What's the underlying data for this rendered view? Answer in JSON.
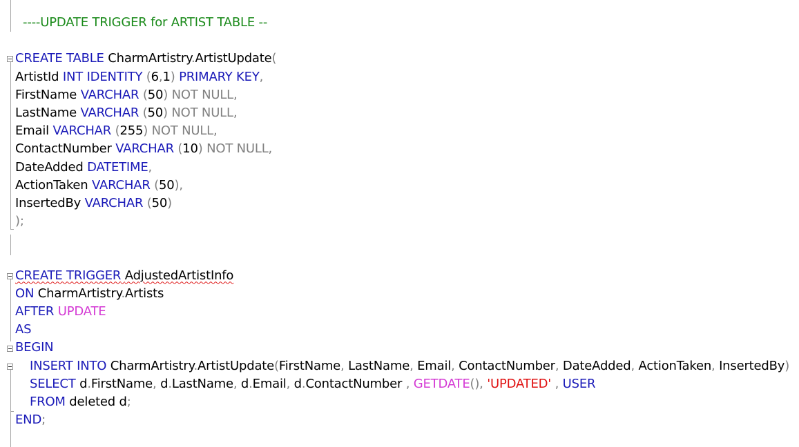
{
  "editor": {
    "colors": {
      "keyword": "#1a1ab8",
      "function": "#d43ad4",
      "operator": "#808080",
      "comment": "#1a8a1a",
      "string": "#e01010",
      "identifier": "#000000"
    },
    "lines": [
      {
        "id": "comment",
        "tokens": [
          {
            "t": "  ----UPDATE TRIGGER for ARTIST TABLE --",
            "c": "cm"
          }
        ]
      },
      {
        "id": "blank-1",
        "tokens": []
      },
      {
        "id": "create-table",
        "tokens": [
          {
            "t": "CREATE TABLE",
            "c": "kw"
          },
          {
            "t": " CharmArtistry",
            "c": ""
          },
          {
            "t": ".",
            "c": "gr"
          },
          {
            "t": "ArtistUpdate",
            "c": ""
          },
          {
            "t": "(",
            "c": "gr"
          }
        ]
      },
      {
        "id": "col-artistid",
        "tokens": [
          {
            "t": "ArtistId ",
            "c": ""
          },
          {
            "t": "INT IDENTITY",
            "c": "kw"
          },
          {
            "t": " (",
            "c": "gr"
          },
          {
            "t": "6",
            "c": ""
          },
          {
            "t": ",",
            "c": "gr"
          },
          {
            "t": "1",
            "c": ""
          },
          {
            "t": ") ",
            "c": "gr"
          },
          {
            "t": "PRIMARY KEY",
            "c": "kw"
          },
          {
            "t": ",",
            "c": "gr"
          }
        ]
      },
      {
        "id": "col-firstname",
        "tokens": [
          {
            "t": "FirstName ",
            "c": ""
          },
          {
            "t": "VARCHAR",
            "c": "kw"
          },
          {
            "t": " (",
            "c": "gr"
          },
          {
            "t": "50",
            "c": ""
          },
          {
            "t": ") NOT NULL,",
            "c": "gr"
          }
        ]
      },
      {
        "id": "col-lastname",
        "tokens": [
          {
            "t": "LastName ",
            "c": ""
          },
          {
            "t": "VARCHAR",
            "c": "kw"
          },
          {
            "t": " (",
            "c": "gr"
          },
          {
            "t": "50",
            "c": ""
          },
          {
            "t": ") NOT NULL,",
            "c": "gr"
          }
        ]
      },
      {
        "id": "col-email",
        "tokens": [
          {
            "t": "Email ",
            "c": ""
          },
          {
            "t": "VARCHAR",
            "c": "kw"
          },
          {
            "t": " (",
            "c": "gr"
          },
          {
            "t": "255",
            "c": ""
          },
          {
            "t": ") NOT NULL,",
            "c": "gr"
          }
        ]
      },
      {
        "id": "col-contactnumber",
        "tokens": [
          {
            "t": "ContactNumber ",
            "c": ""
          },
          {
            "t": "VARCHAR",
            "c": "kw"
          },
          {
            "t": " (",
            "c": "gr"
          },
          {
            "t": "10",
            "c": ""
          },
          {
            "t": ") NOT NULL,",
            "c": "gr"
          }
        ]
      },
      {
        "id": "col-dateadded",
        "tokens": [
          {
            "t": "DateAdded ",
            "c": ""
          },
          {
            "t": "DATETIME",
            "c": "kw"
          },
          {
            "t": ",",
            "c": "gr"
          }
        ]
      },
      {
        "id": "col-actiontaken",
        "tokens": [
          {
            "t": "ActionTaken ",
            "c": ""
          },
          {
            "t": "VARCHAR",
            "c": "kw"
          },
          {
            "t": " (",
            "c": "gr"
          },
          {
            "t": "50",
            "c": ""
          },
          {
            "t": "),",
            "c": "gr"
          }
        ]
      },
      {
        "id": "col-insertedby",
        "tokens": [
          {
            "t": "InsertedBy ",
            "c": ""
          },
          {
            "t": "VARCHAR",
            "c": "kw"
          },
          {
            "t": " (",
            "c": "gr"
          },
          {
            "t": "50",
            "c": ""
          },
          {
            "t": ")",
            "c": "gr"
          }
        ]
      },
      {
        "id": "close-table",
        "tokens": [
          {
            "t": ");",
            "c": "gr"
          }
        ]
      },
      {
        "id": "blank-2",
        "tokens": []
      },
      {
        "id": "blank-3",
        "tokens": []
      },
      {
        "id": "create-trigger",
        "tokens": [
          {
            "t": "CREATE TRIGGER",
            "c": "kw",
            "sq": true
          },
          {
            "t": " ",
            "c": "",
            "sq": true
          },
          {
            "t": "AdjustedArtistInfo",
            "c": "",
            "sq": true
          }
        ]
      },
      {
        "id": "on-clause",
        "tokens": [
          {
            "t": "ON",
            "c": "kw"
          },
          {
            "t": " CharmArtistry",
            "c": ""
          },
          {
            "t": ".",
            "c": "gr"
          },
          {
            "t": "Artists",
            "c": ""
          }
        ]
      },
      {
        "id": "after-update",
        "tokens": [
          {
            "t": "AFTER",
            "c": "kw"
          },
          {
            "t": " ",
            "c": ""
          },
          {
            "t": "UPDATE",
            "c": "fn"
          }
        ]
      },
      {
        "id": "as",
        "tokens": [
          {
            "t": "AS",
            "c": "kw"
          }
        ]
      },
      {
        "id": "begin",
        "tokens": [
          {
            "t": "BEGIN",
            "c": "kw"
          }
        ]
      },
      {
        "id": "insert-into",
        "indent": true,
        "tokens": [
          {
            "t": "INSERT INTO",
            "c": "kw"
          },
          {
            "t": " CharmArtistry",
            "c": ""
          },
          {
            "t": ".",
            "c": "gr"
          },
          {
            "t": "ArtistUpdate",
            "c": ""
          },
          {
            "t": "(",
            "c": "gr"
          },
          {
            "t": "FirstName",
            "c": ""
          },
          {
            "t": ", ",
            "c": "gr"
          },
          {
            "t": "LastName",
            "c": ""
          },
          {
            "t": ", ",
            "c": "gr"
          },
          {
            "t": "Email",
            "c": ""
          },
          {
            "t": ", ",
            "c": "gr"
          },
          {
            "t": "ContactNumber",
            "c": ""
          },
          {
            "t": ", ",
            "c": "gr"
          },
          {
            "t": "DateAdded",
            "c": ""
          },
          {
            "t": ", ",
            "c": "gr"
          },
          {
            "t": "ActionTaken",
            "c": ""
          },
          {
            "t": ", ",
            "c": "gr"
          },
          {
            "t": "InsertedBy",
            "c": ""
          },
          {
            "t": ")",
            "c": "gr"
          }
        ]
      },
      {
        "id": "select",
        "indent": true,
        "tokens": [
          {
            "t": "SELECT",
            "c": "kw"
          },
          {
            "t": " d",
            "c": ""
          },
          {
            "t": ".",
            "c": "gr"
          },
          {
            "t": "FirstName",
            "c": ""
          },
          {
            "t": ", ",
            "c": "gr"
          },
          {
            "t": "d",
            "c": ""
          },
          {
            "t": ".",
            "c": "gr"
          },
          {
            "t": "LastName",
            "c": ""
          },
          {
            "t": ", ",
            "c": "gr"
          },
          {
            "t": "d",
            "c": ""
          },
          {
            "t": ".",
            "c": "gr"
          },
          {
            "t": "Email",
            "c": ""
          },
          {
            "t": ", ",
            "c": "gr"
          },
          {
            "t": "d",
            "c": ""
          },
          {
            "t": ".",
            "c": "gr"
          },
          {
            "t": "ContactNumber",
            "c": ""
          },
          {
            "t": " , ",
            "c": "gr"
          },
          {
            "t": "GETDATE",
            "c": "fn"
          },
          {
            "t": "(), ",
            "c": "gr"
          },
          {
            "t": "'UPDATED'",
            "c": "st"
          },
          {
            "t": " , ",
            "c": "gr"
          },
          {
            "t": "USER",
            "c": "kw"
          }
        ]
      },
      {
        "id": "from",
        "indent": true,
        "tokens": [
          {
            "t": "FROM",
            "c": "kw"
          },
          {
            "t": " deleted d",
            "c": ""
          },
          {
            "t": ";",
            "c": "gr"
          }
        ]
      },
      {
        "id": "end",
        "tokens": [
          {
            "t": "END",
            "c": "kw"
          },
          {
            "t": ";",
            "c": "gr"
          }
        ]
      }
    ]
  }
}
